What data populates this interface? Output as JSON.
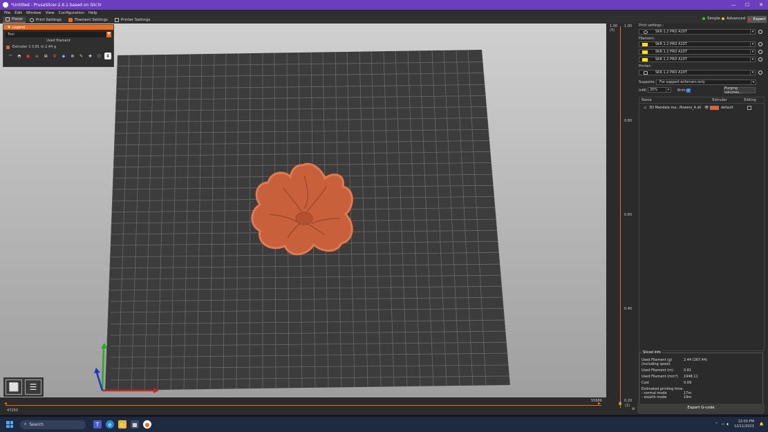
{
  "window": {
    "title": "*Untitled - PrusaSlicer-2.6.1 based on Slic3r",
    "minimize": "—",
    "maximize": "☐",
    "close": "✕"
  },
  "menu": [
    "File",
    "Edit",
    "Window",
    "View",
    "Configuration",
    "Help"
  ],
  "tabs": [
    {
      "label": "Plater",
      "active": true
    },
    {
      "label": "Print Settings",
      "active": false
    },
    {
      "label": "Filament Settings",
      "active": false
    },
    {
      "label": "Printer Settings",
      "active": false
    }
  ],
  "modes": [
    {
      "label": "Simple",
      "color": "#3fbf3f"
    },
    {
      "label": "Advanced",
      "color": "#f0c020"
    },
    {
      "label": "Expert",
      "color": "#e03030"
    }
  ],
  "legend": {
    "header": "Legend",
    "view_type": "Tool",
    "used_filament_title": "Used filament",
    "row": "Extruder 1    0.81 m    2.44 g",
    "swatch": "#d4663f"
  },
  "hslider": {
    "left": "47250",
    "right": "55686"
  },
  "vslider": {
    "top": "1.00",
    "top_sub": "(5)",
    "marks": [
      "0.80",
      "0.60",
      "0.40"
    ],
    "bottom": "0.20",
    "bottom_sub": "(1)"
  },
  "sidebar": {
    "print_settings_label": "Print settings :",
    "print_profile": "SKR 1.2 PRO A10T",
    "filament_label": "Filament:",
    "filaments": [
      "SKR 1.2 PRO A10T",
      "SKR 1.2 PRO A10T",
      "SKR 1.2 PRO A10T"
    ],
    "filament_color": "#ffe600",
    "printer_label": "Printer:",
    "printer_profile": "SKR 1.2 PRO A10T",
    "supports_label": "Supports:",
    "supports_value": "For support enforcers only",
    "infill_label": "Infill:",
    "infill_value": "20%",
    "brim_label": "Brim:",
    "purging_button": "Purging volumes...",
    "table_headers": [
      "Name",
      "Extruder",
      "Editing"
    ],
    "object_name": "3D Mandala ma...flowers_4.stl",
    "object_extruder": "default",
    "object_color": "#d4663f"
  },
  "sliced_info": {
    "title": "Sliced Info",
    "rows": [
      {
        "label": "Used Filament (g)",
        "value": "2.44 (267.44)"
      },
      {
        "label": "    (including spool)",
        "value": ""
      },
      {
        "label": "Used Filament (m)",
        "value": "0.81"
      },
      {
        "label": "Used Filament (mm³)",
        "value": "1948.11"
      },
      {
        "label": "Cost",
        "value": "0.09"
      },
      {
        "label": "Estimated printing time:",
        "value": ""
      },
      {
        "label": "  - normal mode",
        "value": "17m"
      },
      {
        "label": "  - stealth mode",
        "value": "19m"
      }
    ]
  },
  "export_button": "Export G-code",
  "taskbar": {
    "search_placeholder": "Search",
    "time": "12:03 PM",
    "date": "12/11/2023"
  }
}
